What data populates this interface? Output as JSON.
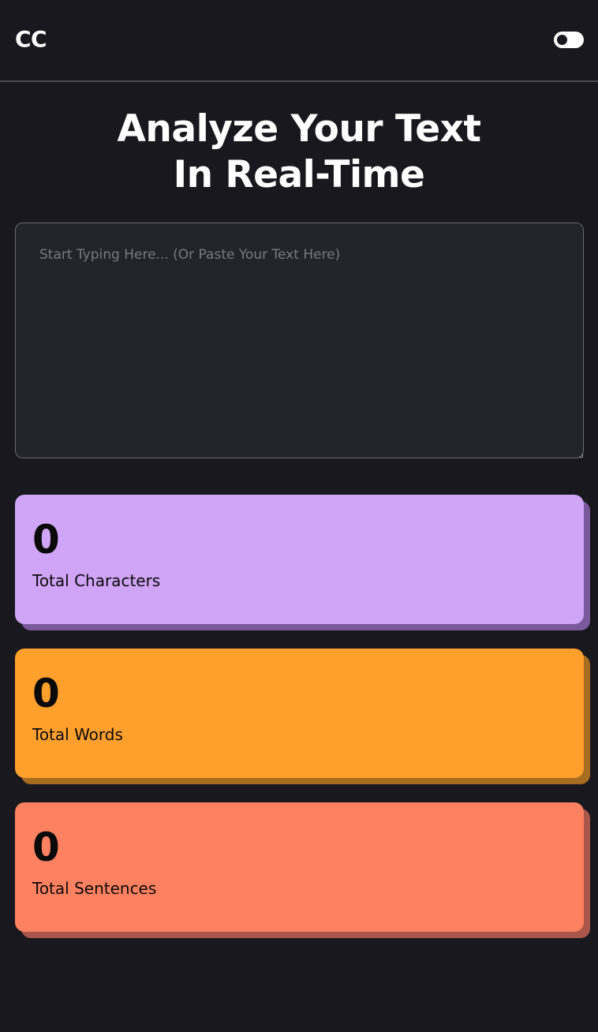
{
  "header": {
    "logo": "CC",
    "theme_toggle": "toggle-icon"
  },
  "headline": {
    "line1": "Analyze Your Text",
    "line2": "In Real-Time"
  },
  "editor": {
    "value": "",
    "placeholder": "Start Typing Here... (Or Paste Your Text Here)"
  },
  "stats": [
    {
      "value": "0",
      "label": "Total Characters",
      "color": "#d0a4f6",
      "shadow": "#7a5a9c"
    },
    {
      "value": "0",
      "label": "Total Words",
      "color": "#fea02b",
      "shadow": "#a66c1f"
    },
    {
      "value": "0",
      "label": "Total Sentences",
      "color": "#fe8161",
      "shadow": "#a8574a"
    }
  ],
  "colors": {
    "background": "#19181f",
    "input_background": "#23232c",
    "divider": "#4a4950"
  }
}
